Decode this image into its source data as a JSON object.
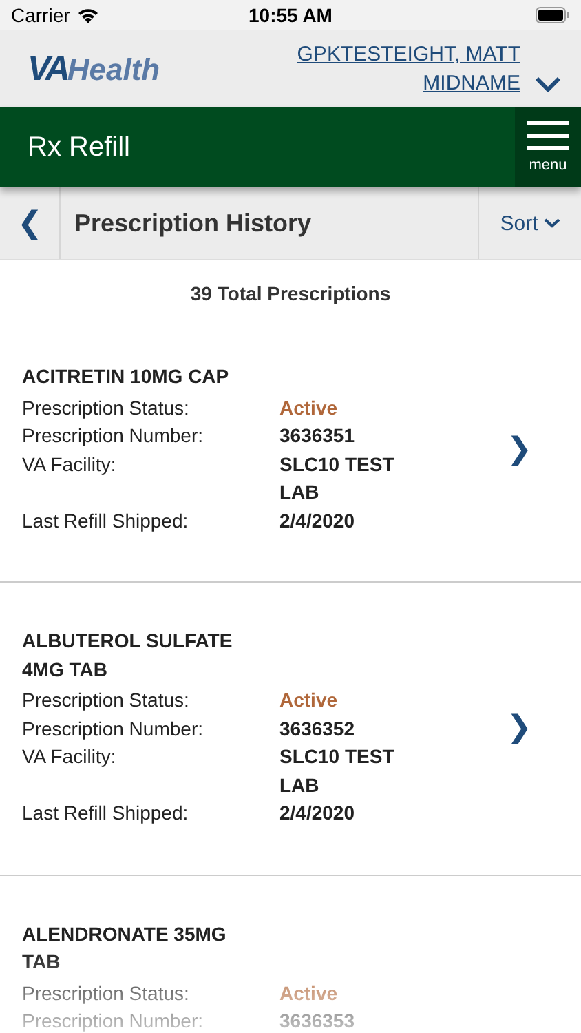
{
  "status_bar": {
    "carrier": "Carrier",
    "time": "10:55 AM"
  },
  "header": {
    "logo_bold": "VA",
    "logo_rest": "Health",
    "user_name": "GPKTESTEIGHT, MATT MIDNAME"
  },
  "nav_bar": {
    "title": "Rx Refill",
    "menu_label": "menu"
  },
  "sub_header": {
    "back_glyph": "❮",
    "title": "Prescription History",
    "sort_label": "Sort"
  },
  "total": "39 Total Prescriptions",
  "prescriptions": [
    {
      "name": "ACITRETIN 10MG CAP",
      "fields": [
        {
          "label": "Prescription Status:",
          "value": "Active",
          "kind": "status"
        },
        {
          "label": "Prescription Number:",
          "value": "3636351",
          "kind": "text"
        },
        {
          "label": "VA Facility:",
          "value": "SLC10 TEST LAB",
          "kind": "text"
        },
        {
          "label": "Last Refill Shipped:",
          "value": "2/4/2020",
          "kind": "text"
        }
      ],
      "chevron": "❯"
    },
    {
      "name": "ALBUTEROL SULFATE 4MG TAB",
      "fields": [
        {
          "label": "Prescription Status:",
          "value": "Active",
          "kind": "status"
        },
        {
          "label": "Prescription Number:",
          "value": "3636352",
          "kind": "text"
        },
        {
          "label": "VA Facility:",
          "value": "SLC10 TEST LAB",
          "kind": "text"
        },
        {
          "label": "Last Refill Shipped:",
          "value": "2/4/2020",
          "kind": "text"
        }
      ],
      "chevron": "❯"
    },
    {
      "name": "ALENDRONATE 35MG TAB",
      "fields": [
        {
          "label": "Prescription Status:",
          "value": "Active",
          "kind": "status"
        },
        {
          "label": "Prescription Number:",
          "value": "3636353",
          "kind": "text"
        }
      ]
    }
  ]
}
